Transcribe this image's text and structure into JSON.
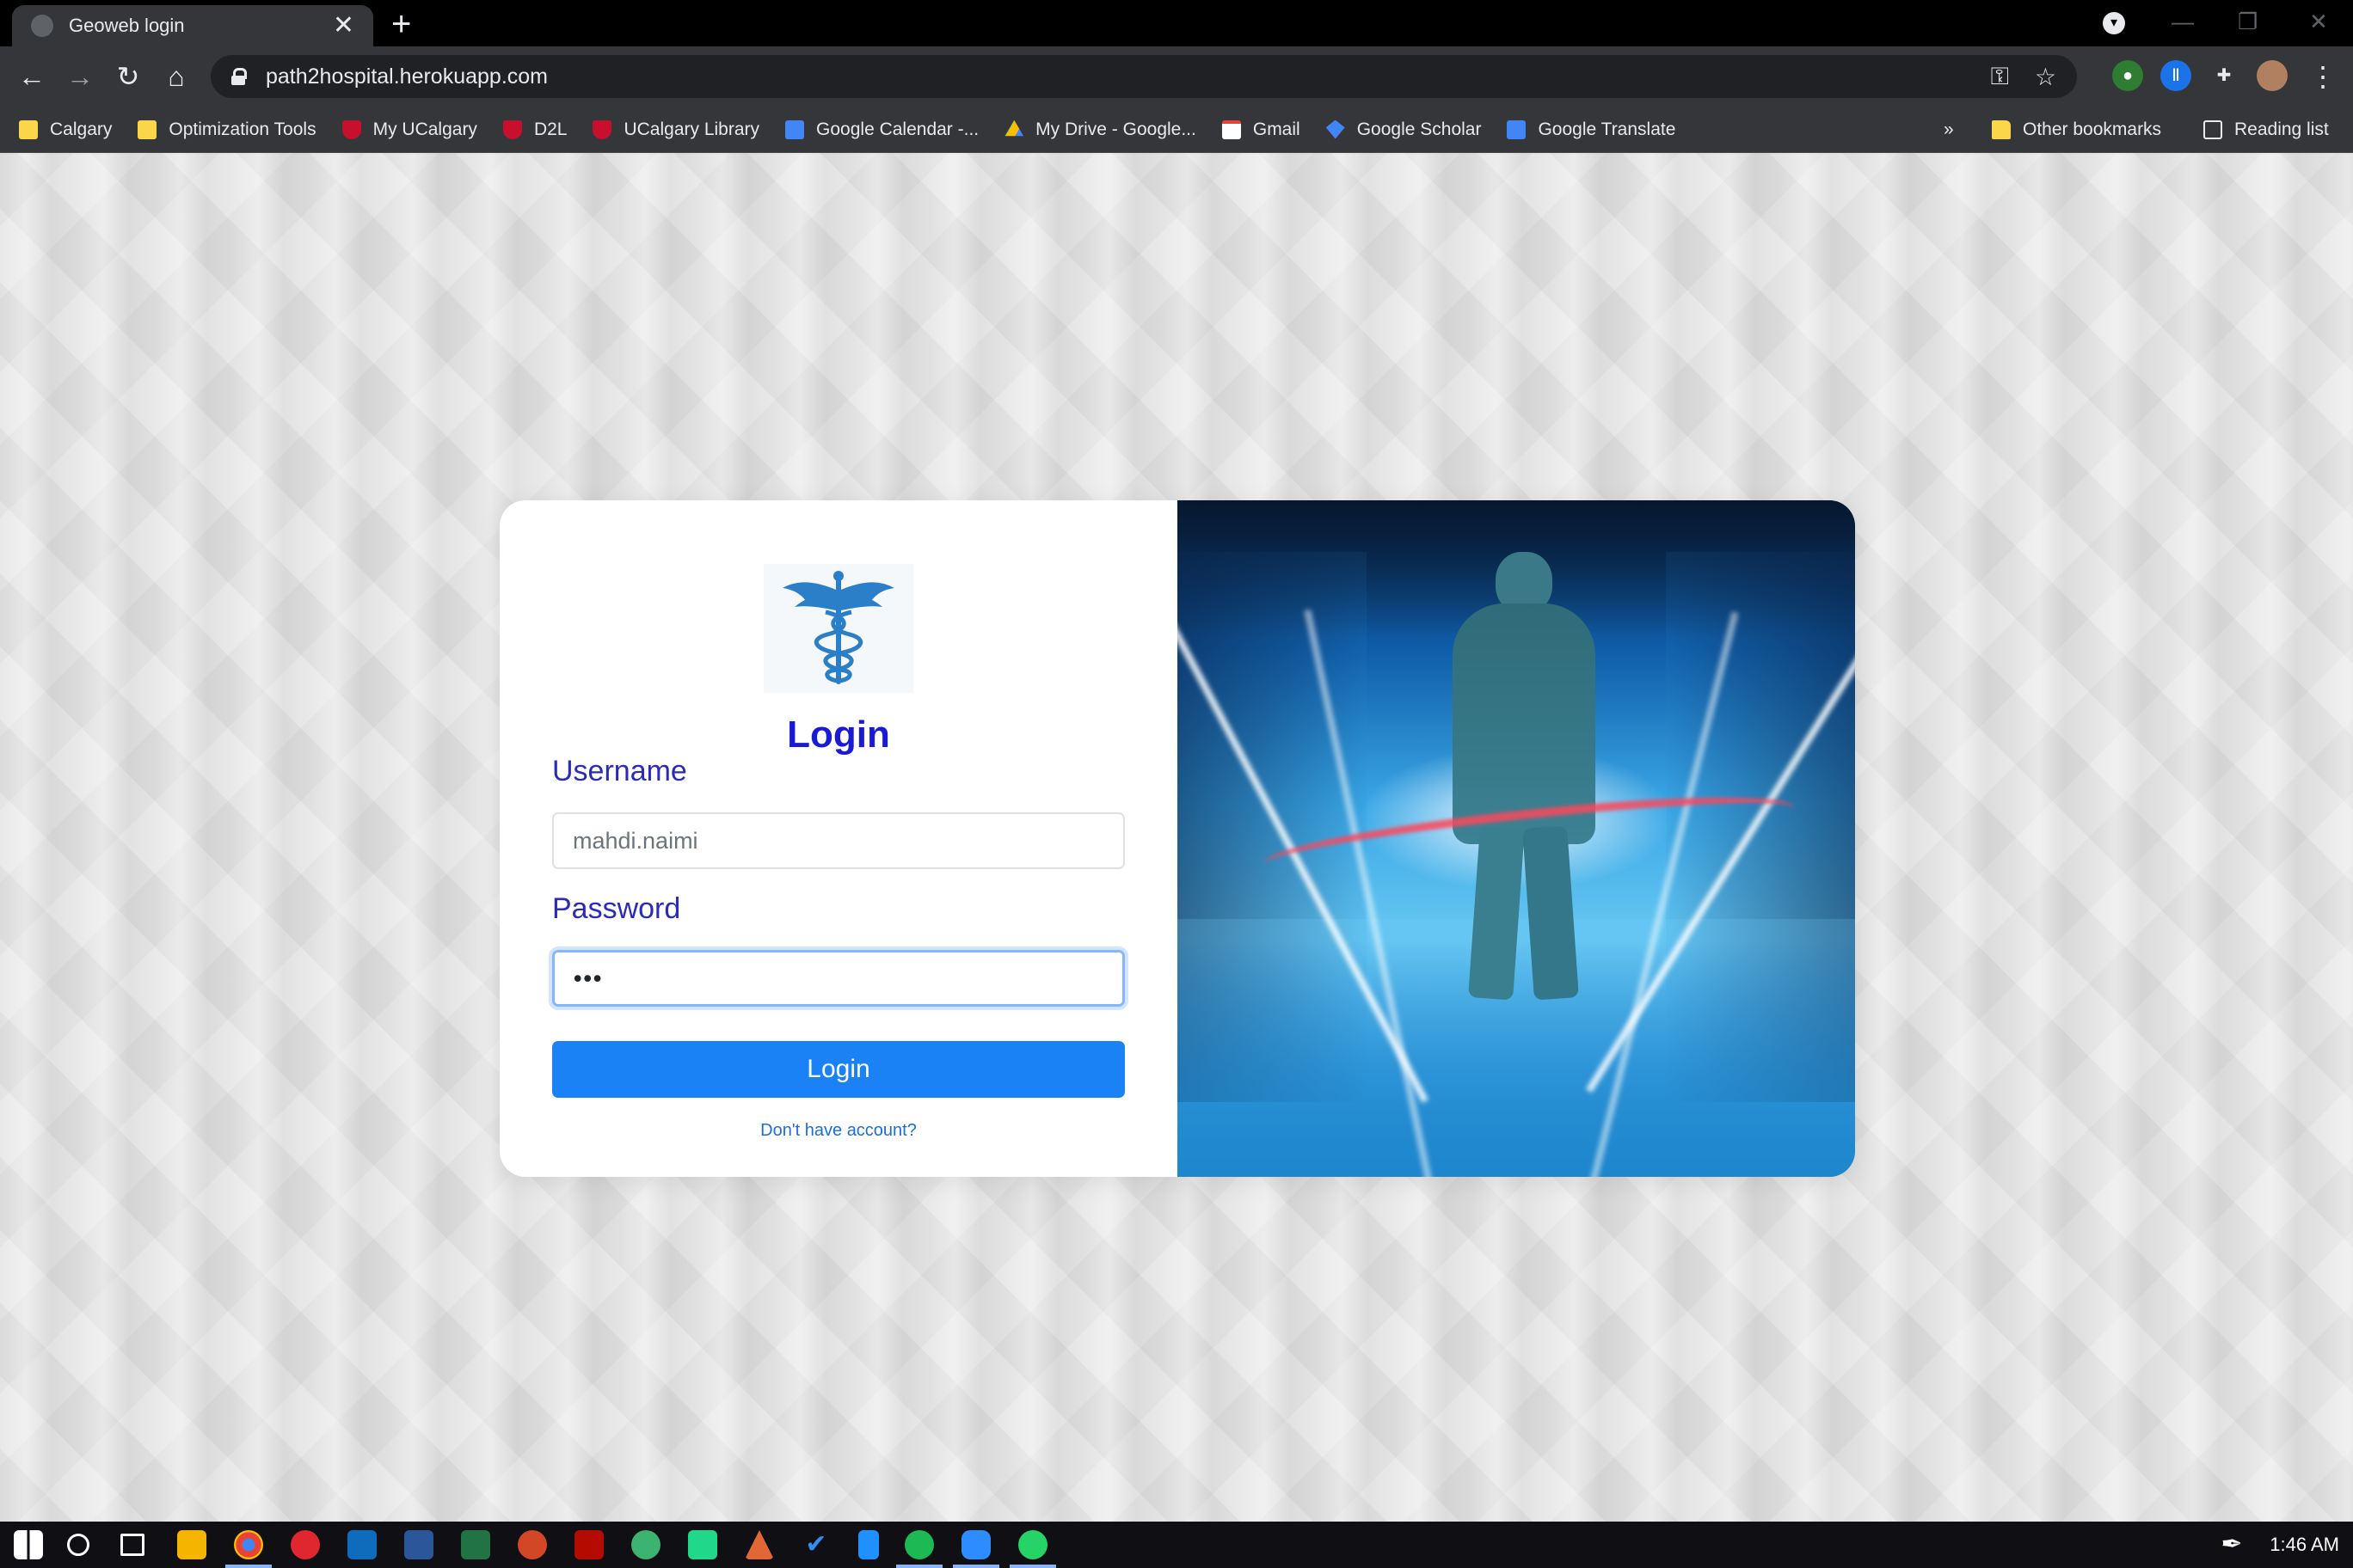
{
  "browser": {
    "tab_title": "Geoweb login",
    "tab_close": "✕",
    "new_tab": "+",
    "url": "path2hospital.herokuapp.com",
    "nav": {
      "back": "←",
      "forward": "→",
      "reload": "↻",
      "home": "⌂"
    },
    "omnibox_icons": {
      "key": "⚿",
      "star": "☆"
    },
    "menu": "⋮",
    "window": {
      "minimize": "—",
      "restore": "❐",
      "close": "✕"
    }
  },
  "bookmarks": {
    "items": [
      {
        "label": "Calgary",
        "icon": "folder-icon"
      },
      {
        "label": "Optimization Tools",
        "icon": "folder-icon"
      },
      {
        "label": "My UCalgary",
        "icon": "ucalgary-shield-icon"
      },
      {
        "label": "D2L",
        "icon": "ucalgary-shield-icon"
      },
      {
        "label": "UCalgary Library",
        "icon": "ucalgary-shield-icon"
      },
      {
        "label": "Google Calendar -...",
        "icon": "google-calendar-icon"
      },
      {
        "label": "My Drive - Google...",
        "icon": "google-drive-icon"
      },
      {
        "label": "Gmail",
        "icon": "gmail-icon"
      },
      {
        "label": "Google Scholar",
        "icon": "google-scholar-icon"
      },
      {
        "label": "Google Translate",
        "icon": "google-translate-icon"
      }
    ],
    "overflow": "»",
    "other": "Other bookmarks",
    "reading_list": "Reading list"
  },
  "login": {
    "title": "Login",
    "username_label": "Username",
    "username_value": "mahdi.naimi",
    "password_label": "Password",
    "password_value": "•••",
    "submit_label": "Login",
    "signup_link": "Don't have account?"
  },
  "colors": {
    "accent": "#1a82f5",
    "title": "#1a1ad6",
    "label": "#2b2bb8",
    "link": "#1a6ed8"
  },
  "taskbar": {
    "clock": "1:46 AM"
  }
}
